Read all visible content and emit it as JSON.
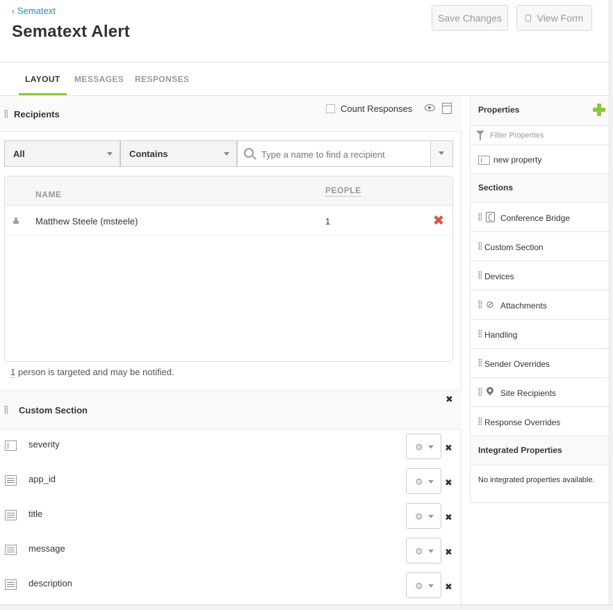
{
  "header": {
    "breadcrumb": "Sematext",
    "title": "Sematext Alert",
    "save_label": "Save Changes",
    "view_label": "View Form"
  },
  "tabs": [
    {
      "label": "LAYOUT",
      "active": true
    },
    {
      "label": "MESSAGES",
      "active": false
    },
    {
      "label": "RESPONSES",
      "active": false
    }
  ],
  "recipients": {
    "title": "Recipients",
    "count_responses_label": "Count Responses",
    "count_responses_checked": false,
    "filter_scope": "All",
    "filter_operator": "Contains",
    "search_placeholder": "Type a name to find a recipient",
    "columns": {
      "name": "NAME",
      "people": "PEOPLE"
    },
    "rows": [
      {
        "icon": "person-icon",
        "name": "Matthew Steele (msteele)",
        "people": "1"
      }
    ],
    "summary_count": "1",
    "summary_text": " person is targeted and may be notified."
  },
  "custom_section": {
    "title": "Custom Section",
    "close": "✖",
    "fields": [
      {
        "label": "severity",
        "icon": "single-line-field-icon"
      },
      {
        "label": "app_id",
        "icon": "text-field-icon"
      },
      {
        "label": "title",
        "icon": "text-field-icon"
      },
      {
        "label": "message",
        "icon": "text-field-icon"
      },
      {
        "label": "description",
        "icon": "text-field-icon"
      }
    ],
    "gear_glyph": "⚙",
    "remove_glyph": "✖"
  },
  "sidebar": {
    "properties_title": "Properties",
    "filter_placeholder": "Filter Properties",
    "property_item": "new property",
    "sections_title": "Sections",
    "sections": [
      {
        "label": "Conference Bridge",
        "icon": "phone-icon"
      },
      {
        "label": "Custom Section",
        "icon": ""
      },
      {
        "label": "Devices",
        "icon": ""
      },
      {
        "label": "Attachments",
        "icon": "paperclip-icon"
      },
      {
        "label": "Handling",
        "icon": ""
      },
      {
        "label": "Sender Overrides",
        "icon": ""
      },
      {
        "label": "Site Recipients",
        "icon": "map-pin-icon"
      },
      {
        "label": "Response Overrides",
        "icon": ""
      }
    ],
    "integrated_title": "Integrated Properties",
    "integrated_empty": "No integrated properties available."
  },
  "colors": {
    "accent_green": "#8dc63f",
    "link_blue": "#1a8ec9",
    "remove_red": "#d9534f"
  }
}
